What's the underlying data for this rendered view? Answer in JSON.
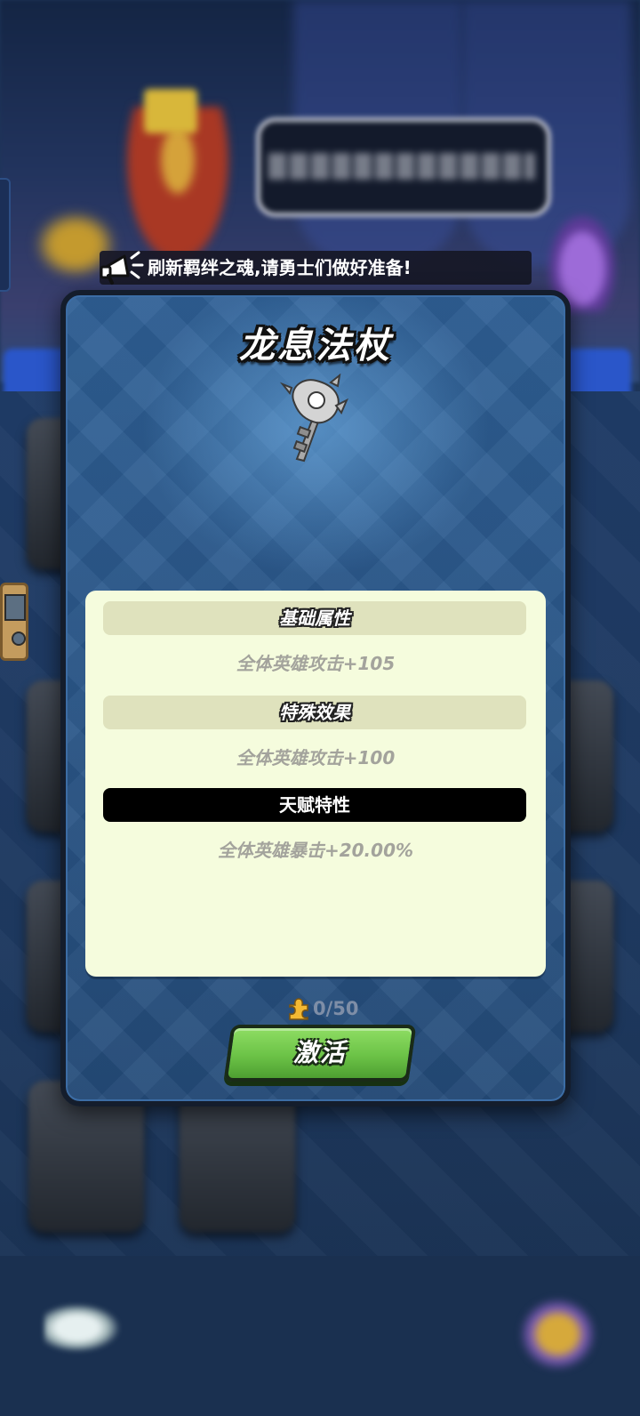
{
  "announcement": {
    "text": "刷新羁绊之魂,请勇士们做好准备!"
  },
  "item_panel": {
    "title": "龙息法杖",
    "sections": [
      {
        "header": "基础属性",
        "value": "全体英雄攻击+105"
      },
      {
        "header": "特殊效果",
        "value": "全体英雄攻击+100"
      },
      {
        "header": "天赋特性",
        "value": "全体英雄暴击+20.00%"
      }
    ],
    "cost": "0/50",
    "activate_label": "激活"
  },
  "icons": {
    "megaphone": "megaphone-icon",
    "item": "dragon-staff-icon",
    "cost": "puzzle-piece-icon",
    "back": "back-arrow-icon"
  },
  "colors": {
    "panel_bg": "#2a5789",
    "info_bg": "#f5fcdd",
    "section_header": "#dfe2bd",
    "talent_header": "#000000",
    "button_green": "#6cc347"
  }
}
